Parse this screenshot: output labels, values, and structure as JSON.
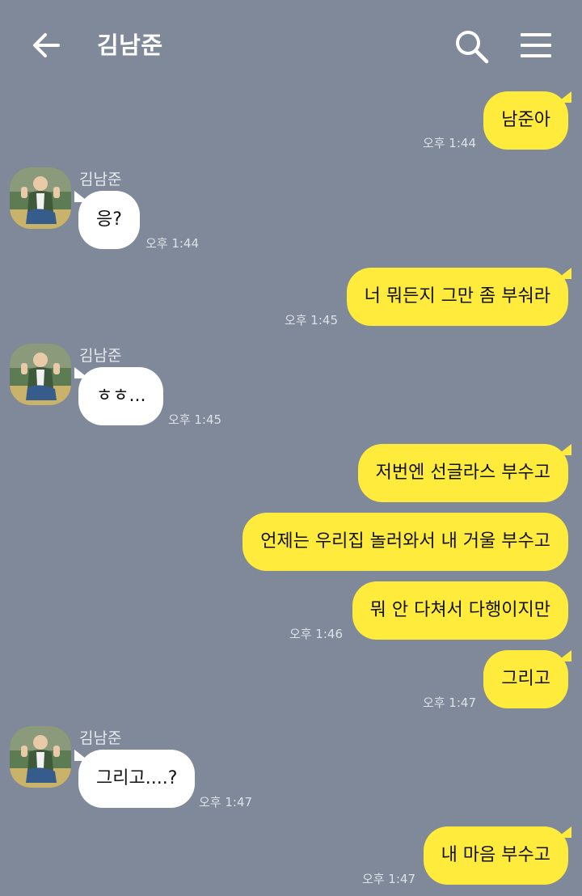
{
  "header": {
    "title": "김남준",
    "back_icon": "arrow-left-icon",
    "search_icon": "search-icon",
    "menu_icon": "hamburger-menu-icon"
  },
  "colors": {
    "background": "#7f8999",
    "my_bubble": "#ffeb3b",
    "their_bubble": "#ffffff"
  },
  "messages": [
    {
      "from": "me",
      "text": "남준아",
      "time": "오후 1:44"
    },
    {
      "from": "them",
      "sender": "김남준",
      "text": "응?",
      "time": "오후 1:44"
    },
    {
      "from": "me",
      "text": "너 뭐든지 그만 좀 부숴라",
      "time": "오후 1:45"
    },
    {
      "from": "them",
      "sender": "김남준",
      "text": "ㅎㅎ...",
      "time": "오후 1:45"
    },
    {
      "from": "me",
      "text": "저번엔 선글라스 부수고"
    },
    {
      "from": "me",
      "text": "언제는 우리집 놀러와서 내 거울 부수고"
    },
    {
      "from": "me",
      "text": "뭐 안 다쳐서 다행이지만",
      "time": "오후 1:46"
    },
    {
      "from": "me",
      "text": "그리고",
      "time": "오후 1:47"
    },
    {
      "from": "them",
      "sender": "김남준",
      "text": "그리고....?",
      "time": "오후 1:47"
    },
    {
      "from": "me",
      "text": "내 마음 부수고",
      "time": "오후 1:47"
    }
  ]
}
